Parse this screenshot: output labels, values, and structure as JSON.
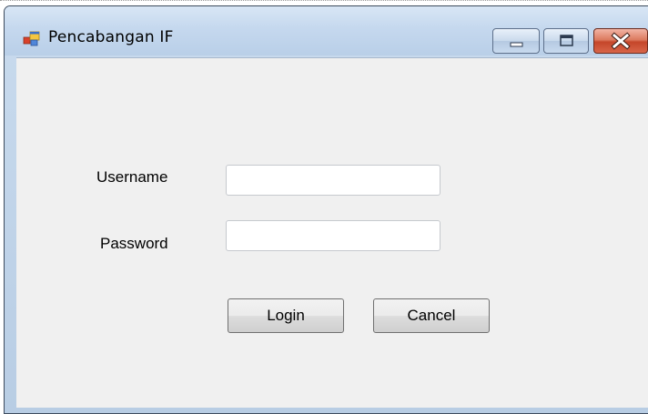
{
  "window": {
    "title": "Pencabangan IF",
    "app_icon": "winforms-app-icon",
    "controls": {
      "minimize_icon": "minimize-icon",
      "maximize_icon": "maximize-icon",
      "close_icon": "close-icon"
    }
  },
  "form": {
    "username_label": "Username",
    "username_value": "",
    "password_label": "Password",
    "password_value": "",
    "login_label": "Login",
    "cancel_label": "Cancel"
  },
  "colors": {
    "client_background": "#f0f0f0",
    "titlebar": "#c5d8ee",
    "close_button": "#c5462a"
  }
}
